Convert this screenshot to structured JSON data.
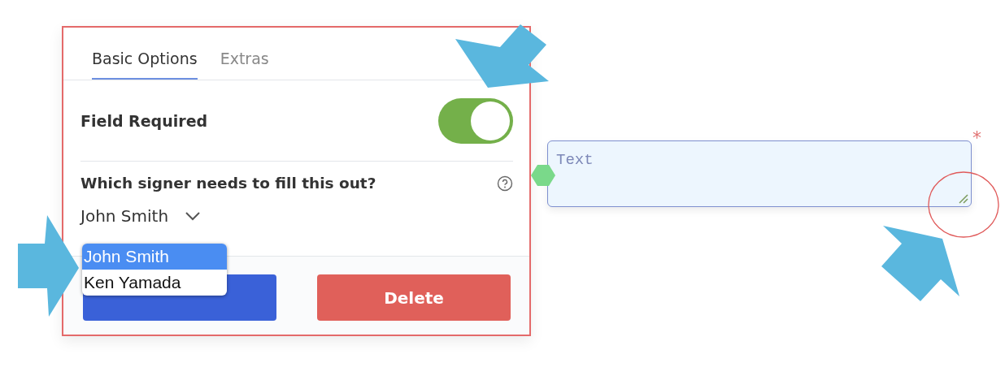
{
  "tabs": [
    {
      "label": "Basic Options",
      "selected": true
    },
    {
      "label": "Extras",
      "selected": false
    }
  ],
  "required": {
    "label": "Field Required",
    "on": true
  },
  "signer": {
    "question": "Which signer needs to fill this out?",
    "value": "John Smith",
    "options": [
      {
        "label": "John Smith",
        "selected": true
      },
      {
        "label": "Ken Yamada",
        "selected": false
      }
    ]
  },
  "buttons": [
    {
      "kind": "save"
    },
    {
      "kind": "delete",
      "label": "Delete"
    }
  ],
  "text_field": {
    "placeholder": "Text",
    "required_mark": "*"
  }
}
